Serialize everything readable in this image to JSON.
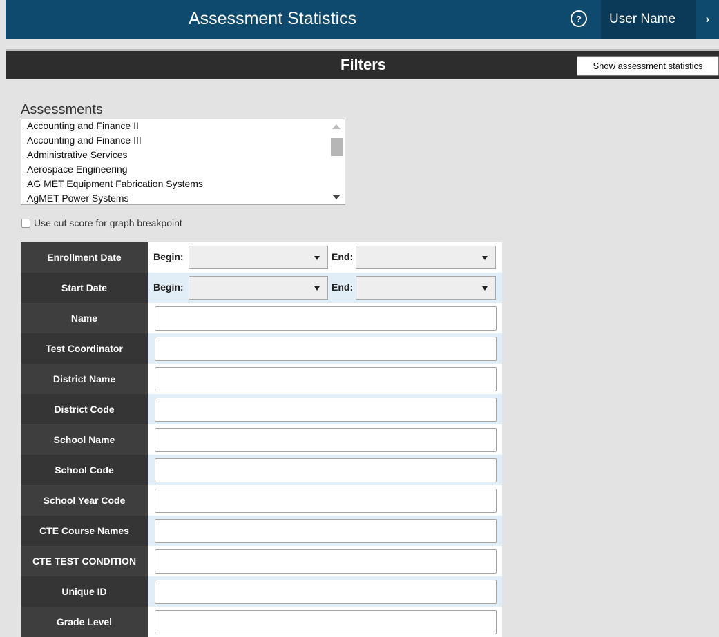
{
  "header": {
    "title": "Assessment Statistics",
    "help_icon": "?",
    "user_name": "User Name",
    "chevron_icon": "›"
  },
  "filters_bar": {
    "title": "Filters",
    "show_button_label": "Show assessment statistics"
  },
  "assessments": {
    "label": "Assessments",
    "items": [
      "Accounting and Finance II",
      "Accounting and Finance III",
      "Administrative Services",
      "Aerospace Engineering",
      "AG MET Equipment Fabrication Systems",
      "AgMET Power Systems"
    ]
  },
  "cut_score": {
    "label": "Use cut score for graph breakpoint",
    "checked": false
  },
  "date_filters": {
    "begin_label": "Begin:",
    "end_label": "End:",
    "rows": [
      "Enrollment Date",
      "Start Date"
    ]
  },
  "text_filters": [
    "Name",
    "Test Coordinator",
    "District Name",
    "District Code",
    "School Name",
    "School Code",
    "School Year Code",
    "CTE Course Names",
    "CTE TEST CONDITION",
    "Unique ID",
    "Grade Level"
  ],
  "colors": {
    "header_bg": "#0e4a6e",
    "user_bg": "#0b3a58",
    "filters_bar_bg": "#2d2d2d",
    "label_bg": "#3e3e3e",
    "alt_row_bg": "#e2eef7",
    "page_bg": "#e3e3e3"
  }
}
